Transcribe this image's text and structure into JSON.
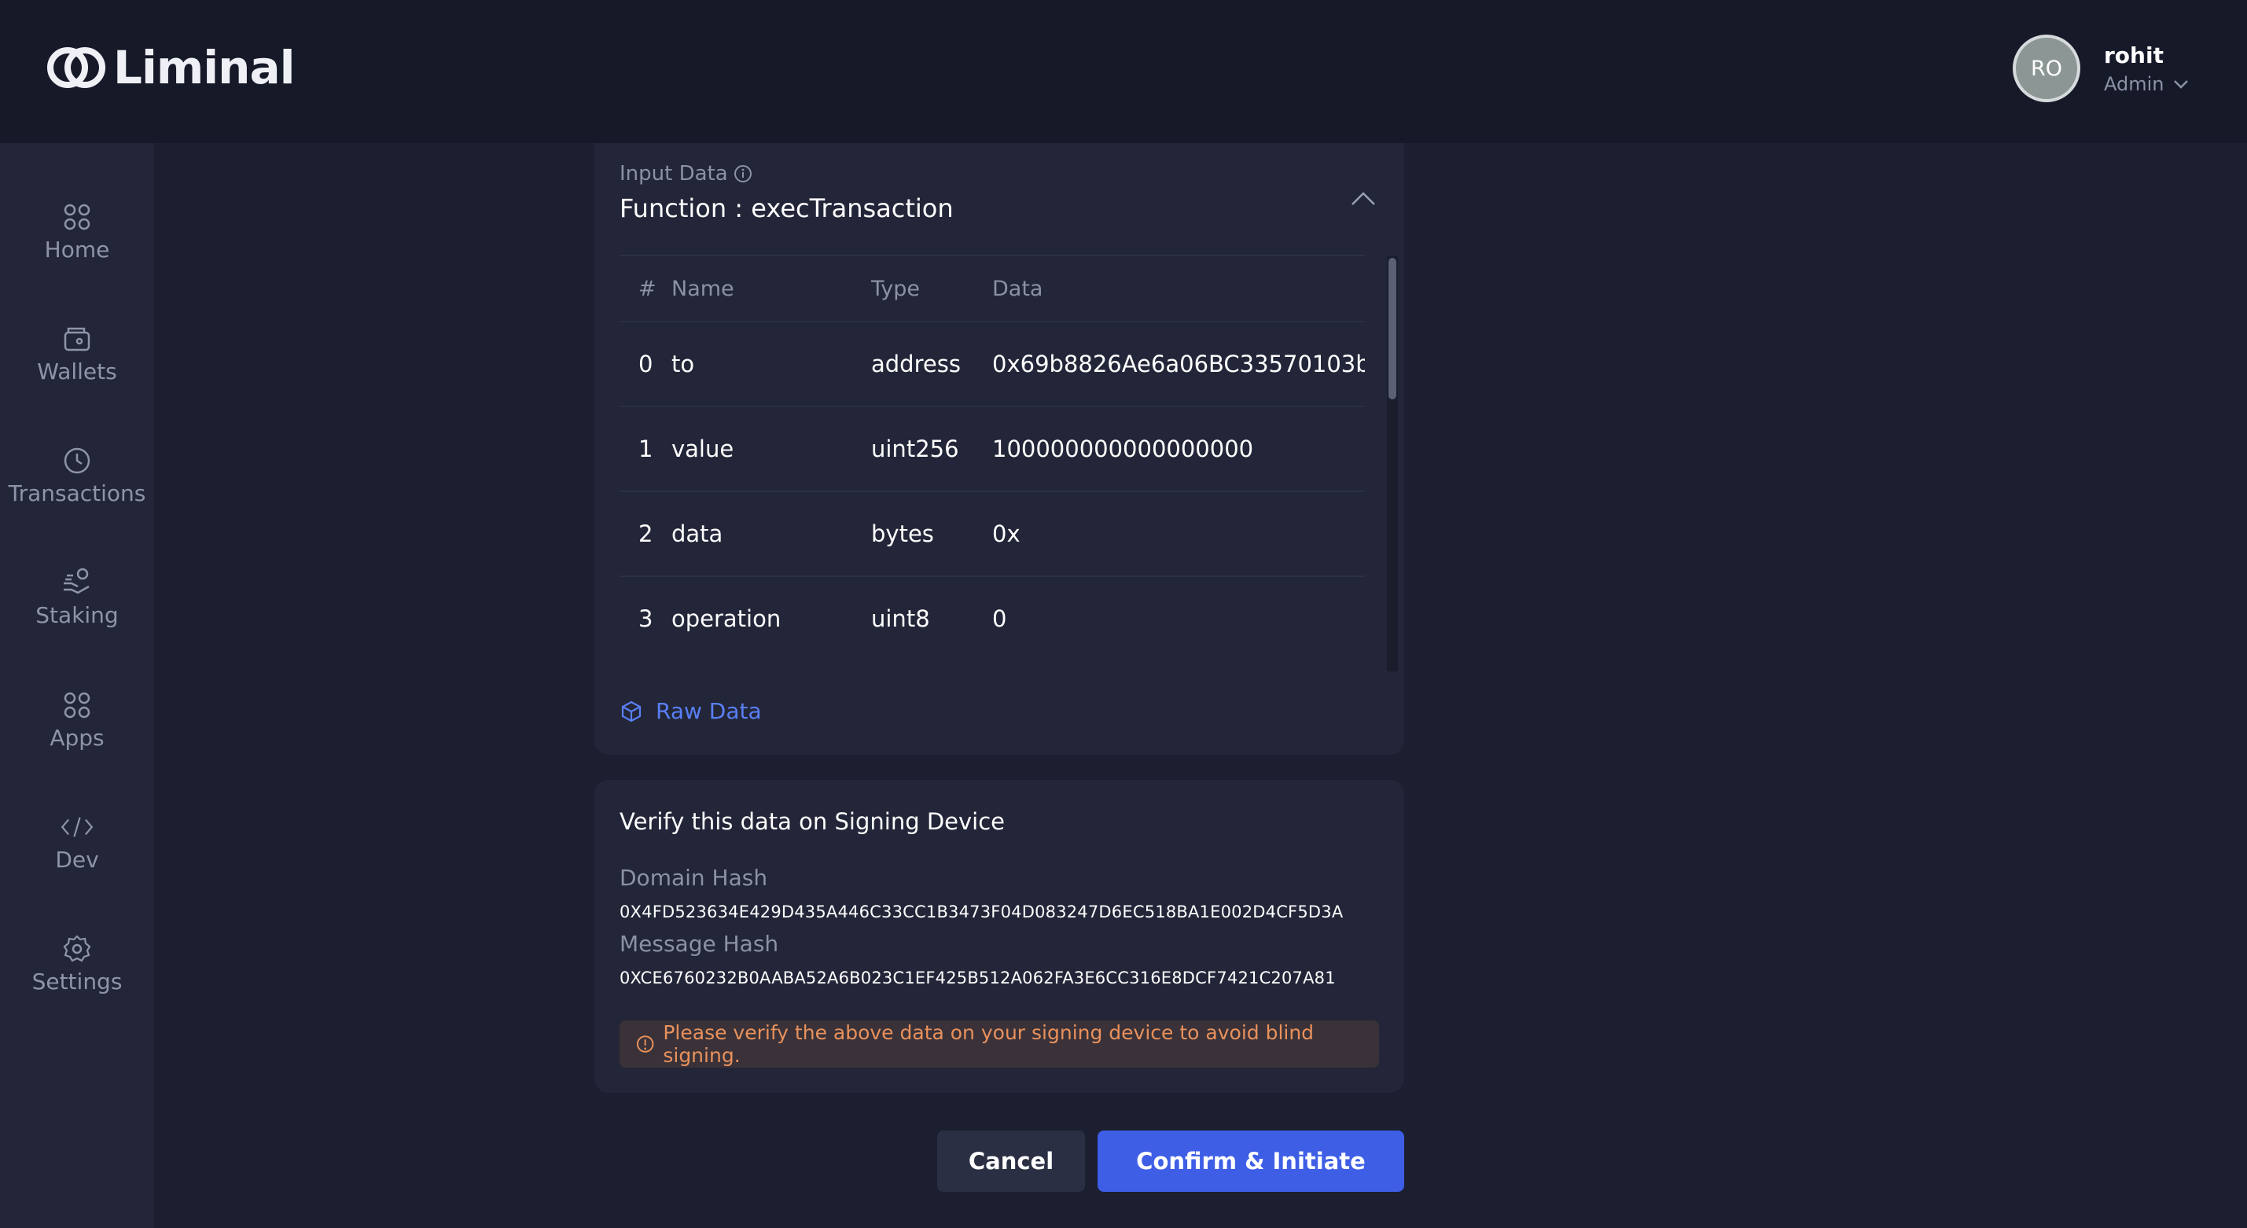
{
  "brand": {
    "name": "Liminal"
  },
  "user": {
    "initials": "RO",
    "name": "rohit",
    "role": "Admin"
  },
  "sidebar": {
    "items": [
      {
        "label": "Home",
        "icon": "grid-icon"
      },
      {
        "label": "Wallets",
        "icon": "wallet-icon"
      },
      {
        "label": "Transactions",
        "icon": "clock-icon"
      },
      {
        "label": "Staking",
        "icon": "staking-hand-icon"
      },
      {
        "label": "Apps",
        "icon": "grid-icon"
      },
      {
        "label": "Dev",
        "icon": "code-icon"
      },
      {
        "label": "Settings",
        "icon": "gear-icon"
      }
    ]
  },
  "input_data": {
    "label": "Input Data",
    "function_title": "Function : execTransaction",
    "columns": [
      "#",
      "Name",
      "Type",
      "Data"
    ],
    "rows": [
      {
        "index": "0",
        "name": "to",
        "type": "address",
        "data": "0x69b8826Ae6a06BC33570103b"
      },
      {
        "index": "1",
        "name": "value",
        "type": "uint256",
        "data": "100000000000000000"
      },
      {
        "index": "2",
        "name": "data",
        "type": "bytes",
        "data": "0x"
      },
      {
        "index": "3",
        "name": "operation",
        "type": "uint8",
        "data": "0"
      }
    ],
    "raw_data_label": "Raw Data"
  },
  "verify": {
    "title": "Verify this data on Signing Device",
    "domain_hash_label": "Domain Hash",
    "domain_hash": "0X4FD523634E429D435A446C33CC1B3473F04D083247D6EC518BA1E002D4CF5D3A",
    "message_hash_label": "Message Hash",
    "message_hash": "0XCE6760232B0AABA52A6B023C1EF425B512A062FA3E6CC316E8DCF7421C207A81",
    "warning": "Please verify the above data on your signing device to avoid blind signing."
  },
  "actions": {
    "cancel_label": "Cancel",
    "confirm_label": "Confirm & Initiate"
  },
  "colors": {
    "accent": "#3e5ee6",
    "link": "#5a7ff5",
    "warning_text": "#e9915c",
    "background": "#1c1f30",
    "sidebar": "#232638"
  }
}
